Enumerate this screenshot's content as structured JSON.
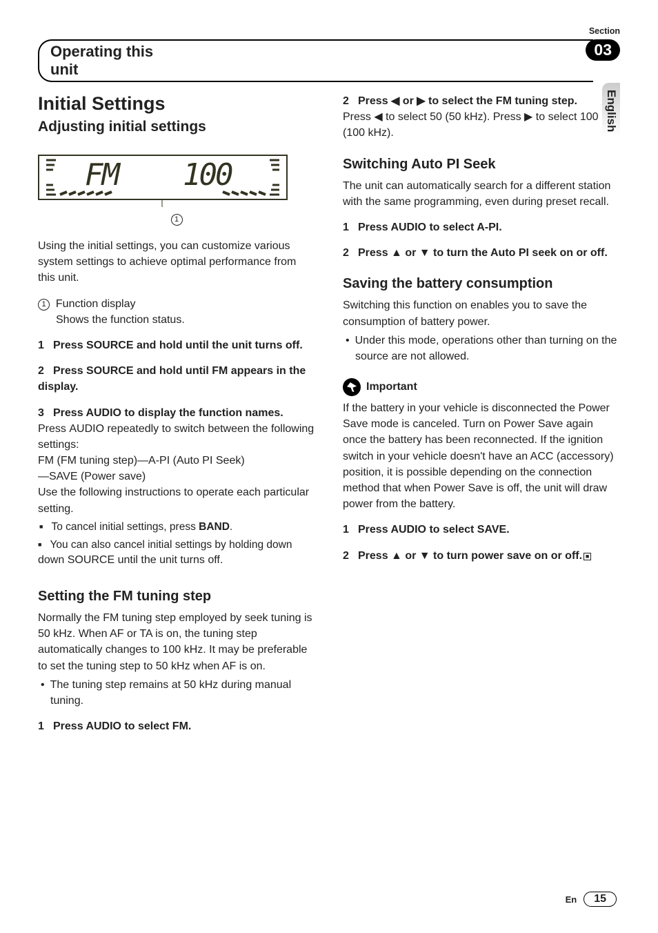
{
  "header": {
    "section_label": "Section",
    "section_number": "03",
    "tab_title": "Operating this unit",
    "language": "English"
  },
  "left": {
    "h1": "Initial Settings",
    "h2": "Adjusting initial settings",
    "display": {
      "band": "FM",
      "value": "100",
      "callout": "1"
    },
    "intro": "Using the initial settings, you can customize various system settings to achieve optimal performance from this unit.",
    "legend_num": "1",
    "legend_title": "Function display",
    "legend_desc": "Shows the function status.",
    "step1": "Press SOURCE and hold until the unit turns off.",
    "step2": "Press SOURCE and hold until FM appears in the display.",
    "step3": "Press AUDIO to display the function names.",
    "after3_a": "Press ",
    "after3_a_bold": "AUDIO",
    "after3_b": " repeatedly to switch between the following settings:",
    "settings_line": "FM (FM tuning step)—A-PI (Auto PI Seek)—SAVE (Power save)",
    "after3_c": "Use the following instructions to operate each particular setting.",
    "bullet1_a": "To cancel initial settings, press ",
    "bullet1_b": "BAND",
    "bullet1_c": ".",
    "bullet2_a": "You can also cancel initial settings by holding down ",
    "bullet2_b": "SOURCE",
    "bullet2_c": " until the unit turns off.",
    "h3_fm": "Setting the FM tuning step",
    "fm_para": "Normally the FM tuning step employed by seek tuning is 50 kHz. When AF or TA is on, the tuning step automatically changes to 100 kHz. It may be preferable to set the tuning step to 50 kHz when AF is on.",
    "fm_bullet": "The tuning step remains at 50 kHz during manual tuning.",
    "fm_step1": "Press AUDIO to select FM."
  },
  "right": {
    "step2_line": "Press ◀ or ▶ to select the FM tuning step.",
    "step2_body_a": "Press ◀ to select ",
    "step2_body_b": "50",
    "step2_body_c": " (50 kHz). Press ▶ to select ",
    "step2_body_d": "100",
    "step2_body_e": " (100 kHz).",
    "h3_pi": "Switching Auto PI Seek",
    "pi_para": "The unit can automatically search for a different station with the same programming, even during preset recall.",
    "pi_step1": "Press AUDIO to select A-PI.",
    "pi_step2": "Press ▲ or ▼ to turn the Auto PI seek on or off.",
    "h3_save": "Saving the battery consumption",
    "save_para": "Switching this function on enables you to save the consumption of battery power.",
    "save_bullet": "Under this mode, operations other than turning on the source are not allowed.",
    "important_label": "Important",
    "important_para": "If the battery in your vehicle is disconnected the Power Save mode is canceled. Turn on Power Save again once the battery has been reconnected. If the ignition switch in your vehicle doesn't have an ACC (accessory) position, it is possible depending on the connection method that when Power Save is off, the unit will draw power from the battery.",
    "save_step1": "Press AUDIO to select SAVE.",
    "save_step2": "Press ▲ or ▼ to turn power save on or off.",
    "endmark": "■"
  },
  "footer": {
    "lang_short": "En",
    "page": "15"
  }
}
